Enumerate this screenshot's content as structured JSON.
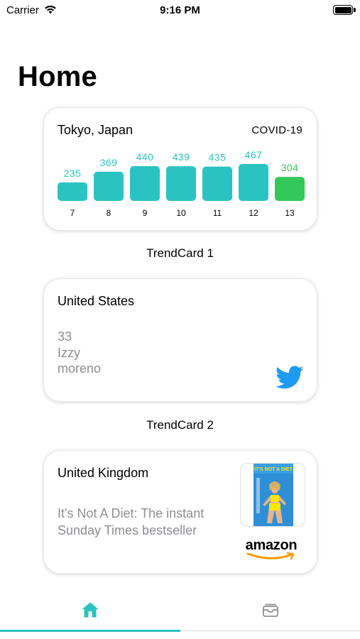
{
  "status_bar": {
    "carrier": "Carrier",
    "time": "9:16 PM"
  },
  "page": {
    "title": "Home"
  },
  "colors": {
    "accent": "#2bc3c1",
    "highlight": "#34c759",
    "secondary_text": "#8e8e93",
    "twitter": "#1d9bf0"
  },
  "covid_card": {
    "location": "Tokyo, Japan",
    "tag": "COVID-19",
    "caption": "TrendCard 1"
  },
  "chart_data": {
    "type": "bar",
    "categories": [
      "7",
      "8",
      "9",
      "10",
      "11",
      "12",
      "13"
    ],
    "values": [
      235,
      369,
      440,
      439,
      435,
      467,
      304
    ],
    "highlight_index": 6,
    "ylim": [
      0,
      467
    ]
  },
  "twitter_card": {
    "location": "United States",
    "lines": [
      "33",
      "Izzy",
      "moreno"
    ],
    "icon": "twitter-bird-icon",
    "caption": "TrendCard 2"
  },
  "amazon_card": {
    "location": "United Kingdom",
    "book_title": "It's Not A Diet: The instant Sunday Times bestseller",
    "cover_text": "IT'S NOT A DIET",
    "brand": "amazon"
  },
  "tab_bar": {
    "items": [
      {
        "icon": "house-icon",
        "selected": true
      },
      {
        "icon": "wallet-icon",
        "selected": false
      }
    ]
  }
}
